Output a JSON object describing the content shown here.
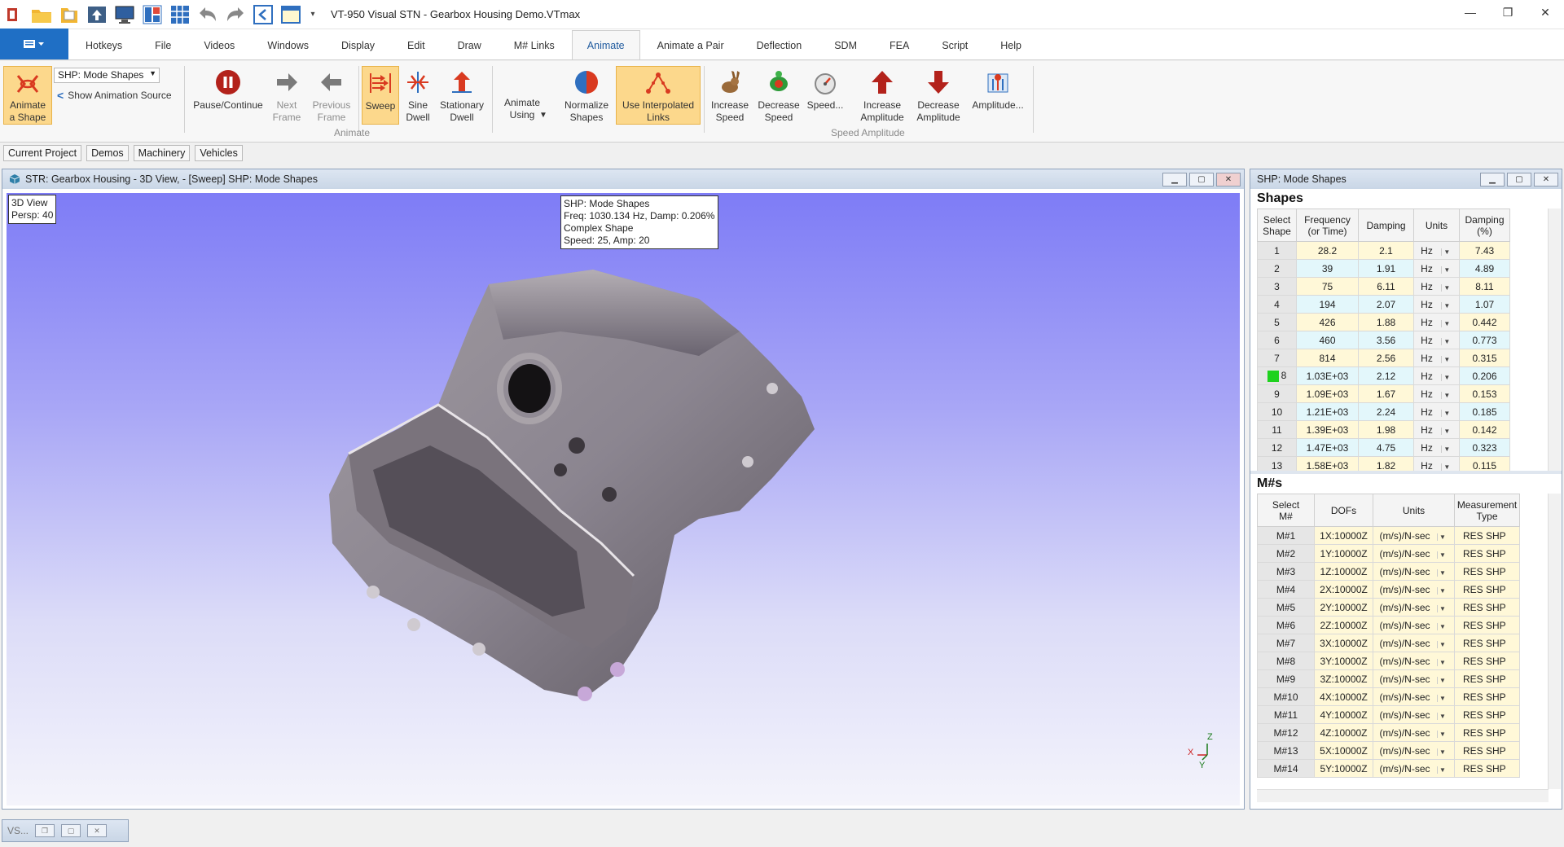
{
  "window": {
    "title": "VT-950 Visual STN - Gearbox Housing Demo.VTmax"
  },
  "window_controls": {
    "minimize": "—",
    "restore": "❐",
    "close": "✕"
  },
  "qat_more": "▾",
  "tabs": [
    "Hotkeys",
    "File",
    "Videos",
    "Windows",
    "Display",
    "Edit",
    "Draw",
    "M# Links",
    "Animate",
    "Animate a Pair",
    "Deflection",
    "SDM",
    "FEA",
    "Script",
    "Help"
  ],
  "active_tab": "Animate",
  "ribbon": {
    "animate_shape": "Animate\na Shape",
    "shape_combo": "SHP: Mode Shapes",
    "show_source": "Show Animation Source",
    "pause_continue": "Pause/Continue",
    "next_frame": "Next\nFrame",
    "previous_frame": "Previous\nFrame",
    "sweep": "Sweep",
    "sine_dwell": "Sine\nDwell",
    "stationary_dwell": "Stationary\nDwell",
    "animate_using": "Animate\nUsing",
    "normalize_shapes": "Normalize\nShapes",
    "use_interpolated_links": "Use Interpolated\nLinks",
    "increase_speed": "Increase\nSpeed",
    "decrease_speed": "Decrease\nSpeed",
    "speed": "Speed...",
    "increase_amplitude": "Increase\nAmplitude",
    "decrease_amplitude": "Decrease\nAmplitude",
    "amplitude": "Amplitude...",
    "group_animate": "Animate",
    "group_speed_amplitude": "Speed Amplitude"
  },
  "project_tabs": [
    "Current Project",
    "Demos",
    "Machinery",
    "Vehicles"
  ],
  "view3d": {
    "title": "STR: Gearbox Housing - 3D View, - [Sweep] SHP: Mode Shapes",
    "corner_label_1": "3D View",
    "corner_label_2": "Persp: 40",
    "info_1": "SHP: Mode Shapes",
    "info_2": "Freq: 1030.134 Hz, Damp: 0.206%",
    "info_3": "Complex Shape",
    "info_4": "Speed: 25, Amp: 20",
    "axis_x": "X",
    "axis_y": "Y",
    "axis_z": "Z",
    "colors": {
      "bg_top": "#7e7cf6",
      "bg_bottom": "#f4f4fb"
    }
  },
  "shp_panel": {
    "title": "SHP: Mode Shapes",
    "section": "Shapes",
    "headers": [
      "Select\nShape",
      "Frequency\n(or Time)",
      "Damping",
      "Units",
      "Damping\n(%)"
    ],
    "rows": [
      [
        "1",
        "28.2",
        "2.1",
        "Hz",
        "7.43"
      ],
      [
        "2",
        "39",
        "1.91",
        "Hz",
        "4.89"
      ],
      [
        "3",
        "75",
        "6.11",
        "Hz",
        "8.11"
      ],
      [
        "4",
        "194",
        "2.07",
        "Hz",
        "1.07"
      ],
      [
        "5",
        "426",
        "1.88",
        "Hz",
        "0.442"
      ],
      [
        "6",
        "460",
        "3.56",
        "Hz",
        "0.773"
      ],
      [
        "7",
        "814",
        "2.56",
        "Hz",
        "0.315"
      ],
      [
        "8",
        "1.03E+03",
        "2.12",
        "Hz",
        "0.206"
      ],
      [
        "9",
        "1.09E+03",
        "1.67",
        "Hz",
        "0.153"
      ],
      [
        "10",
        "1.21E+03",
        "2.24",
        "Hz",
        "0.185"
      ],
      [
        "11",
        "1.39E+03",
        "1.98",
        "Hz",
        "0.142"
      ],
      [
        "12",
        "1.47E+03",
        "4.75",
        "Hz",
        "0.323"
      ],
      [
        "13",
        "1.58E+03",
        "1.82",
        "Hz",
        "0.115"
      ]
    ],
    "selected_row": "8"
  },
  "mnum_panel": {
    "section": "M#s",
    "headers": [
      "Select\nM#",
      "DOFs",
      "Units",
      "Measurement\nType"
    ],
    "rows": [
      [
        "M#1",
        "1X:10000Z",
        "(m/s)/N-sec",
        "RES SHP"
      ],
      [
        "M#2",
        "1Y:10000Z",
        "(m/s)/N-sec",
        "RES SHP"
      ],
      [
        "M#3",
        "1Z:10000Z",
        "(m/s)/N-sec",
        "RES SHP"
      ],
      [
        "M#4",
        "2X:10000Z",
        "(m/s)/N-sec",
        "RES SHP"
      ],
      [
        "M#5",
        "2Y:10000Z",
        "(m/s)/N-sec",
        "RES SHP"
      ],
      [
        "M#6",
        "2Z:10000Z",
        "(m/s)/N-sec",
        "RES SHP"
      ],
      [
        "M#7",
        "3X:10000Z",
        "(m/s)/N-sec",
        "RES SHP"
      ],
      [
        "M#8",
        "3Y:10000Z",
        "(m/s)/N-sec",
        "RES SHP"
      ],
      [
        "M#9",
        "3Z:10000Z",
        "(m/s)/N-sec",
        "RES SHP"
      ],
      [
        "M#10",
        "4X:10000Z",
        "(m/s)/N-sec",
        "RES SHP"
      ],
      [
        "M#11",
        "4Y:10000Z",
        "(m/s)/N-sec",
        "RES SHP"
      ],
      [
        "M#12",
        "4Z:10000Z",
        "(m/s)/N-sec",
        "RES SHP"
      ],
      [
        "M#13",
        "5X:10000Z",
        "(m/s)/N-sec",
        "RES SHP"
      ],
      [
        "M#14",
        "5Y:10000Z",
        "(m/s)/N-sec",
        "RES SHP"
      ]
    ]
  },
  "minimized_window": {
    "label": "VS..."
  }
}
